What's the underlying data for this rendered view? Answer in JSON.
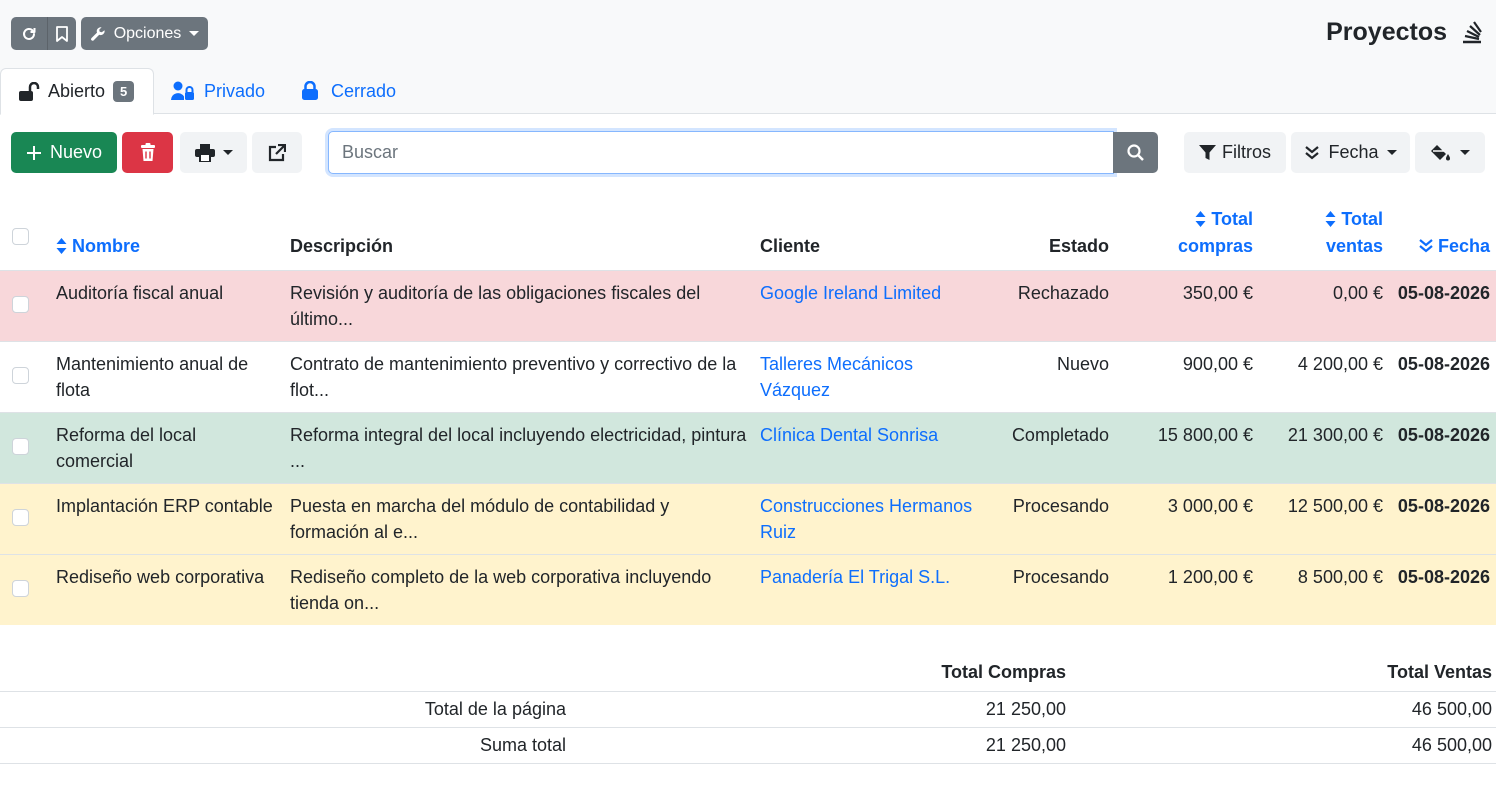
{
  "toolbar_top": {
    "options_label": "Opciones",
    "page_title": "Proyectos"
  },
  "tabs": [
    {
      "label": "Abierto",
      "count": "5"
    },
    {
      "label": "Privado"
    },
    {
      "label": "Cerrado"
    }
  ],
  "actions": {
    "new_label": "Nuevo",
    "filters_label": "Filtros",
    "order_label": "Fecha"
  },
  "search": {
    "placeholder": "Buscar",
    "value": ""
  },
  "table": {
    "headers": {
      "name": "Nombre",
      "description": "Descripción",
      "customer": "Cliente",
      "status": "Estado",
      "total_purchases": "Total compras",
      "total_sales": "Total ventas",
      "date": "Fecha"
    },
    "rows": [
      {
        "name": "Auditoría fiscal anual",
        "description": "Revisión y auditoría de las obligaciones fiscales del último...",
        "customer": "Google Ireland Limited",
        "status": "Rechazado",
        "purchases": "350,00 €",
        "sales": "0,00 €",
        "date": "05-08-2026",
        "color": "danger"
      },
      {
        "name": "Mantenimiento anual de flota",
        "description": "Contrato de mantenimiento preventivo y correctivo de la flot...",
        "customer": "Talleres Mecánicos Vázquez",
        "status": "Nuevo",
        "purchases": "900,00 €",
        "sales": "4 200,00 €",
        "date": "05-08-2026",
        "color": "none"
      },
      {
        "name": "Reforma del local comercial",
        "description": "Reforma integral del local incluyendo electricidad, pintura ...",
        "customer": "Clínica Dental Sonrisa",
        "status": "Completado",
        "purchases": "15 800,00 €",
        "sales": "21 300,00 €",
        "date": "05-08-2026",
        "color": "success"
      },
      {
        "name": "Implantación ERP contable",
        "description": "Puesta en marcha del módulo de contabilidad y formación al e...",
        "customer": "Construcciones Hermanos Ruiz",
        "status": "Procesando",
        "purchases": "3 000,00 €",
        "sales": "12 500,00 €",
        "date": "05-08-2026",
        "color": "warning"
      },
      {
        "name": "Rediseño web corporativa",
        "description": "Rediseño completo de la web corporativa incluyendo tienda on...",
        "customer": "Panadería El Trigal S.L.",
        "status": "Procesando",
        "purchases": "1 200,00 €",
        "sales": "8 500,00 €",
        "date": "05-08-2026",
        "color": "warning"
      }
    ]
  },
  "totals": {
    "header_purchases": "Total Compras",
    "header_sales": "Total Ventas",
    "rows": [
      {
        "label": "Total de la página",
        "purchases": "21 250,00",
        "sales": "46 500,00"
      },
      {
        "label": "Suma total",
        "purchases": "21 250,00",
        "sales": "46 500,00"
      }
    ]
  },
  "colors": {
    "primary": "#0d6efd",
    "success": "#198754",
    "danger": "#dc3545",
    "secondary": "#6c757d",
    "row_danger": "#f8d7da",
    "row_success": "#d1e7dd",
    "row_warning": "#fff3cd"
  },
  "icons": [
    "refresh-icon",
    "bookmark-icon",
    "wrench-icon",
    "unlock-icon",
    "user-lock-icon",
    "lock-icon",
    "plus-icon",
    "trash-icon",
    "print-icon",
    "external-link-icon",
    "search-icon",
    "filter-icon",
    "sort-desc-icon",
    "paint-bucket-icon",
    "stack-icon"
  ]
}
